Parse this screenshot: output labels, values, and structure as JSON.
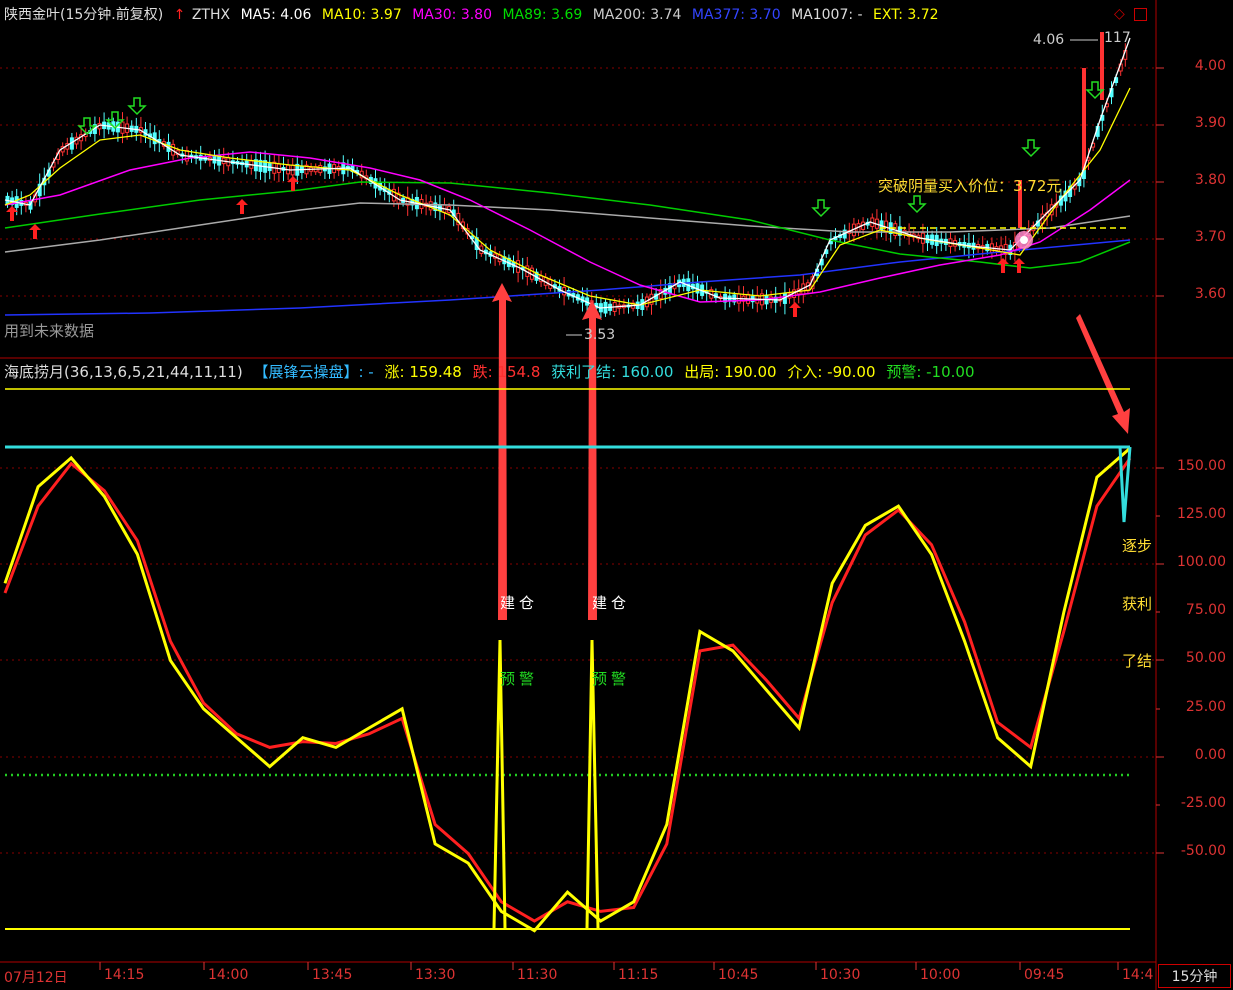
{
  "price_header": {
    "symbol": "陕西金叶(15分钟.前复权)",
    "indicator": "ZTHX",
    "ma5": "MA5: 4.06",
    "ma10": "MA10: 3.97",
    "ma30": "MA30: 3.80",
    "ma89": "MA89: 3.69",
    "ma200": "MA200: 3.74",
    "ma377": "MA377: 3.70",
    "ma1007": "MA1007: -",
    "ext": "EXT: 3.72"
  },
  "price_axis": [
    "4.00",
    "3.90",
    "3.80",
    "3.70",
    "3.60"
  ],
  "price_notes": {
    "future_data": "用到未来数据",
    "breakout": "突破阴量买入价位：3.72元",
    "high": "4.06",
    "high_right": "117",
    "low": "3.53"
  },
  "indicator_header": {
    "name": "海底捞月(36,13,6,5,21,44,11,11)",
    "panel": "【展锋云操盘】: -",
    "rise": "涨: 159.48",
    "fall": "跌: 154.8",
    "take_profit": "获利了结: 160.00",
    "exit": "出局: 190.00",
    "enter": "介入: -90.00",
    "warn": "预警: -10.00"
  },
  "indicator_axis": [
    "150.00",
    "125.00",
    "100.00",
    "75.00",
    "50.00",
    "25.00",
    "0.00",
    "-25.00",
    "-50.00"
  ],
  "indicator_notes": {
    "build1": "建仓",
    "build2": "建仓",
    "warn1": "预警",
    "warn2": "预警",
    "side1": "逐步",
    "side2": "获利",
    "side3": "了结"
  },
  "time_axis": [
    "07月12日",
    "14:15",
    "14:00",
    "13:45",
    "13:30",
    "11:30",
    "11:15",
    "10:45",
    "10:30",
    "10:00",
    "09:45",
    "14:4"
  ],
  "period": "15分钟",
  "colors": {
    "up": "#ff3232",
    "down": "#54ffff",
    "ma5": "#ffffff",
    "ma10": "#ffff00",
    "ma30": "#ff00ff",
    "ma89": "#00cc00",
    "ma200": "#aaaaaa",
    "ma377": "#2233ff",
    "grid": "#880000"
  },
  "chart_data": [
    {
      "type": "line",
      "title": "海底捞月(36,13,6,5,21,44,11,11)",
      "ylim": [
        -75,
        165
      ],
      "reference_lines": [
        160,
        -90,
        -10,
        190
      ],
      "series": [
        {
          "name": "涨",
          "values": [
            90,
            140,
            155,
            135,
            105,
            50,
            25,
            10,
            -5,
            10,
            5,
            15,
            25,
            -45,
            -55,
            -80,
            -90,
            -70,
            -85,
            -75,
            -35,
            65,
            55,
            35,
            15,
            90,
            120,
            130,
            105,
            60,
            10,
            -5,
            75,
            145,
            160
          ]
        },
        {
          "name": "跌",
          "values": [
            85,
            130,
            152,
            138,
            112,
            60,
            28,
            12,
            5,
            8,
            7,
            12,
            20,
            -35,
            -50,
            -75,
            -85,
            -75,
            -80,
            -78,
            -45,
            55,
            58,
            40,
            20,
            80,
            115,
            128,
            110,
            70,
            18,
            5,
            65,
            130,
            154.8
          ]
        }
      ]
    }
  ]
}
